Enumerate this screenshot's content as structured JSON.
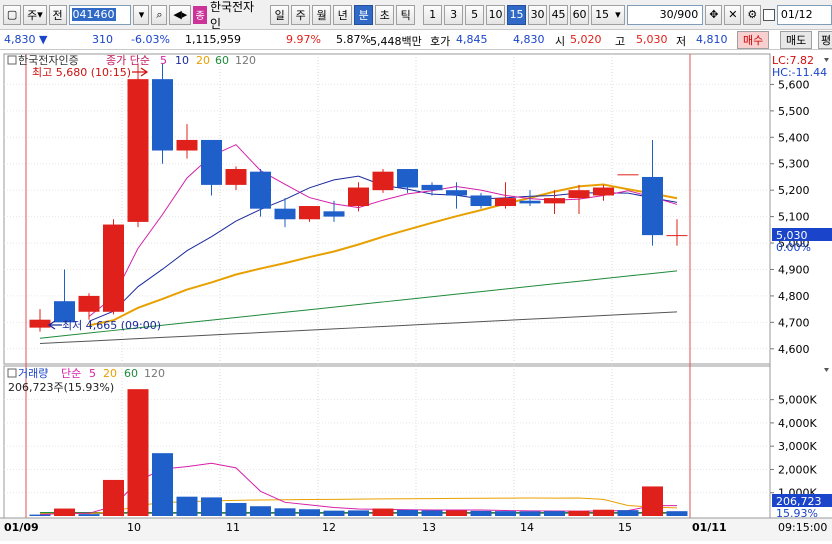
{
  "toolbar": {
    "code": "041460",
    "type_select": "주",
    "sub_select": "전",
    "badge": "종",
    "stock_name": "한국전자인",
    "period_buttons": [
      "일",
      "주",
      "월",
      "년",
      "분",
      "초",
      "틱"
    ],
    "active_period": "분",
    "interval_buttons": [
      "1",
      "3",
      "5",
      "10",
      "15",
      "30",
      "45",
      "60"
    ],
    "active_interval": "15",
    "interval_select": "15",
    "count": "30/900",
    "date": "01/12"
  },
  "quote": {
    "price": "4,830",
    "change": "310",
    "change_pct": "-6.03%",
    "volume": "1,115,959",
    "vol_ratio": "9.97%",
    "turnover": "5.87%",
    "amount": "5,448백만",
    "label_hoga": "호가",
    "ask": "4,845",
    "bid": "4,830",
    "label_open": "시",
    "open": "5,020",
    "label_high": "고",
    "high": "5,030",
    "label_low": "저",
    "low": "4,810",
    "buy_label": "매수",
    "sell_label": "매도",
    "eval_label": "평"
  },
  "price_panel": {
    "title": "한국전자인증",
    "ma_label": "종가 단순",
    "ma_periods": [
      "5",
      "10",
      "20",
      "60",
      "120"
    ],
    "ma_colors": [
      "#d61fa8",
      "#1a2a9c",
      "#e8a000",
      "#1f8a3a",
      "#555555"
    ],
    "high_marker": "최고 5,680 (10:15)",
    "low_marker": "최저 4,665 (09:00)",
    "lc": "LC:7.82",
    "hc": "HC:-11.44",
    "y_ticks": [
      "5,600",
      "5,500",
      "5,400",
      "5,300",
      "5,200",
      "5,100",
      "5,000",
      "4,900",
      "4,800",
      "4,700",
      "4,600"
    ],
    "current_price_box": "5,030",
    "current_pct": "0.00%"
  },
  "volume_panel": {
    "title": "거래량",
    "ma_label": "단순",
    "ma_periods": [
      "5",
      "20",
      "60",
      "120"
    ],
    "current_text": "206,723주(15.93%)",
    "y_ticks": [
      "5,000K",
      "4,000K",
      "3,000K",
      "2,000K",
      "1,000K"
    ],
    "current_box": "206,723",
    "current_pct": "15.93%"
  },
  "x_axis": {
    "labels": [
      "01/09",
      "10",
      "11",
      "12",
      "13",
      "14",
      "15",
      "01/11"
    ],
    "time": "09:15:00"
  },
  "chart_data": {
    "type": "candlestick",
    "ylim": [
      4550,
      5700
    ],
    "candles": [
      {
        "o": 4680,
        "h": 4750,
        "l": 4665,
        "c": 4710
      },
      {
        "o": 4780,
        "h": 4900,
        "l": 4700,
        "c": 4700
      },
      {
        "o": 4740,
        "h": 4810,
        "l": 4710,
        "c": 4800
      },
      {
        "o": 4740,
        "h": 5090,
        "l": 4730,
        "c": 5070
      },
      {
        "o": 5080,
        "h": 5680,
        "l": 5060,
        "c": 5620
      },
      {
        "o": 5620,
        "h": 5680,
        "l": 5300,
        "c": 5350
      },
      {
        "o": 5350,
        "h": 5450,
        "l": 5320,
        "c": 5390
      },
      {
        "o": 5390,
        "h": 5390,
        "l": 5180,
        "c": 5220
      },
      {
        "o": 5220,
        "h": 5290,
        "l": 5200,
        "c": 5280
      },
      {
        "o": 5270,
        "h": 5280,
        "l": 5100,
        "c": 5130
      },
      {
        "o": 5130,
        "h": 5170,
        "l": 5060,
        "c": 5090
      },
      {
        "o": 5090,
        "h": 5140,
        "l": 5080,
        "c": 5140
      },
      {
        "o": 5120,
        "h": 5160,
        "l": 5080,
        "c": 5100
      },
      {
        "o": 5140,
        "h": 5230,
        "l": 5120,
        "c": 5210
      },
      {
        "o": 5200,
        "h": 5280,
        "l": 5190,
        "c": 5270
      },
      {
        "o": 5280,
        "h": 5280,
        "l": 5190,
        "c": 5210
      },
      {
        "o": 5220,
        "h": 5230,
        "l": 5180,
        "c": 5200
      },
      {
        "o": 5200,
        "h": 5230,
        "l": 5130,
        "c": 5180
      },
      {
        "o": 5180,
        "h": 5190,
        "l": 5130,
        "c": 5140
      },
      {
        "o": 5140,
        "h": 5230,
        "l": 5130,
        "c": 5170
      },
      {
        "o": 5160,
        "h": 5200,
        "l": 5140,
        "c": 5150
      },
      {
        "o": 5150,
        "h": 5200,
        "l": 5110,
        "c": 5170
      },
      {
        "o": 5170,
        "h": 5220,
        "l": 5110,
        "c": 5200
      },
      {
        "o": 5180,
        "h": 5220,
        "l": 5160,
        "c": 5210
      },
      {
        "o": 5260,
        "h": 5260,
        "l": 5260,
        "c": 5260
      },
      {
        "o": 5250,
        "h": 5390,
        "l": 4990,
        "c": 5030
      },
      {
        "o": 5030,
        "h": 5090,
        "l": 4990,
        "c": 5030
      }
    ],
    "volume_ylim": [
      0,
      5500
    ],
    "volumes": [
      60,
      320,
      80,
      1550,
      5450,
      2700,
      830,
      800,
      560,
      420,
      330,
      290,
      230,
      240,
      320,
      260,
      240,
      240,
      220,
      210,
      200,
      210,
      220,
      270,
      250,
      1270,
      207
    ],
    "volume_colors": [
      "b",
      "r",
      "b",
      "r",
      "r",
      "b",
      "b",
      "b",
      "b",
      "b",
      "b",
      "b",
      "b",
      "b",
      "r",
      "b",
      "b",
      "r",
      "b",
      "b",
      "b",
      "b",
      "r",
      "r",
      "b",
      "r",
      "b"
    ]
  }
}
